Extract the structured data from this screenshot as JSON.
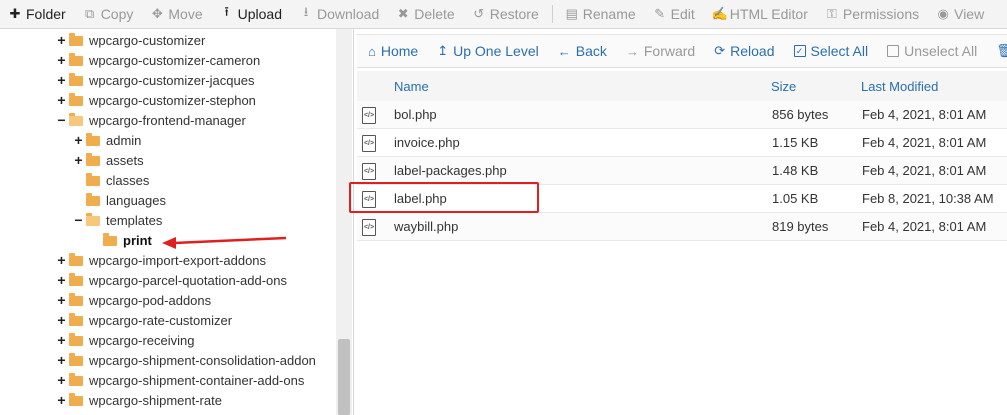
{
  "toolbar": {
    "buttons": [
      {
        "label": "Folder",
        "icon": "plus-icon",
        "glyph": "✚",
        "enabled": true
      },
      {
        "label": "Copy",
        "icon": "copy-icon",
        "glyph": "⧉",
        "enabled": false
      },
      {
        "label": "Move",
        "icon": "move-icon",
        "glyph": "✥",
        "enabled": false
      },
      {
        "label": "Upload",
        "icon": "upload-icon",
        "glyph": "⭱",
        "enabled": true
      },
      {
        "label": "Download",
        "icon": "download-icon",
        "glyph": "⭳",
        "enabled": false
      },
      {
        "label": "Delete",
        "icon": "delete-icon",
        "glyph": "✖",
        "enabled": false
      },
      {
        "label": "Restore",
        "icon": "restore-icon",
        "glyph": "↺",
        "enabled": false
      },
      {
        "label": "Rename",
        "icon": "rename-icon",
        "glyph": "▤",
        "enabled": false
      },
      {
        "label": "Edit",
        "icon": "edit-icon",
        "glyph": "✎",
        "enabled": false
      },
      {
        "label": "HTML Editor",
        "icon": "html-editor-icon",
        "glyph": "✍",
        "enabled": false
      },
      {
        "label": "Permissions",
        "icon": "key-icon",
        "glyph": "⚿",
        "enabled": false
      },
      {
        "label": "View",
        "icon": "eye-icon",
        "glyph": "◉",
        "enabled": false
      }
    ]
  },
  "tree": {
    "items": [
      {
        "label": "wpcargo-customizer",
        "toggle": "+",
        "depth": 0,
        "open": false
      },
      {
        "label": "wpcargo-customizer-cameron",
        "toggle": "+",
        "depth": 0,
        "open": false
      },
      {
        "label": "wpcargo-customizer-jacques",
        "toggle": "+",
        "depth": 0,
        "open": false
      },
      {
        "label": "wpcargo-customizer-stephon",
        "toggle": "+",
        "depth": 0,
        "open": false
      },
      {
        "label": "wpcargo-frontend-manager",
        "toggle": "−",
        "depth": 0,
        "open": true
      },
      {
        "label": "admin",
        "toggle": "+",
        "depth": 1,
        "open": false
      },
      {
        "label": "assets",
        "toggle": "+",
        "depth": 1,
        "open": false
      },
      {
        "label": "classes",
        "toggle": "",
        "depth": 1,
        "open": false
      },
      {
        "label": "languages",
        "toggle": "",
        "depth": 1,
        "open": false
      },
      {
        "label": "templates",
        "toggle": "−",
        "depth": 1,
        "open": true
      },
      {
        "label": "print",
        "toggle": "",
        "depth": 2,
        "open": false,
        "current": true
      },
      {
        "label": "wpcargo-import-export-addons",
        "toggle": "+",
        "depth": 0,
        "open": false
      },
      {
        "label": "wpcargo-parcel-quotation-add-ons",
        "toggle": "+",
        "depth": 0,
        "open": false
      },
      {
        "label": "wpcargo-pod-addons",
        "toggle": "+",
        "depth": 0,
        "open": false
      },
      {
        "label": "wpcargo-rate-customizer",
        "toggle": "+",
        "depth": 0,
        "open": false
      },
      {
        "label": "wpcargo-receiving",
        "toggle": "+",
        "depth": 0,
        "open": false
      },
      {
        "label": "wpcargo-shipment-consolidation-addon",
        "toggle": "+",
        "depth": 0,
        "open": false
      },
      {
        "label": "wpcargo-shipment-container-add-ons",
        "toggle": "+",
        "depth": 0,
        "open": false
      },
      {
        "label": "wpcargo-shipment-rate",
        "toggle": "+",
        "depth": 0,
        "open": false
      }
    ]
  },
  "nav": {
    "buttons": [
      {
        "label": "Home",
        "icon": "home-icon",
        "glyph": "⌂",
        "enabled": true
      },
      {
        "label": "Up One Level",
        "icon": "up-level-icon",
        "glyph": "↥",
        "enabled": true
      },
      {
        "label": "Back",
        "icon": "back-icon",
        "glyph": "←",
        "enabled": true
      },
      {
        "label": "Forward",
        "icon": "forward-icon",
        "glyph": "→",
        "enabled": false
      },
      {
        "label": "Reload",
        "icon": "reload-icon",
        "glyph": "⟳",
        "enabled": true
      },
      {
        "label": "Select All",
        "icon": "checkbox-checked-icon",
        "glyph": "✓",
        "enabled": true
      },
      {
        "label": "Unselect All",
        "icon": "checkbox-empty-icon",
        "glyph": "",
        "enabled": false
      },
      {
        "label": "",
        "icon": "trash-icon",
        "glyph": "🗑",
        "enabled": true
      }
    ]
  },
  "table": {
    "columns": {
      "name": "Name",
      "size": "Size",
      "modified": "Last Modified"
    },
    "rows": [
      {
        "name": "bol.php",
        "size": "856 bytes",
        "modified": "Feb 4, 2021, 8:01 AM"
      },
      {
        "name": "invoice.php",
        "size": "1.15 KB",
        "modified": "Feb 4, 2021, 8:01 AM"
      },
      {
        "name": "label-packages.php",
        "size": "1.48 KB",
        "modified": "Feb 4, 2021, 8:01 AM"
      },
      {
        "name": "label.php",
        "size": "1.05 KB",
        "modified": "Feb 8, 2021, 10:38 AM",
        "highlighted": true
      },
      {
        "name": "waybill.php",
        "size": "819 bytes",
        "modified": "Feb 4, 2021, 8:01 AM"
      }
    ]
  },
  "colors": {
    "link_blue": "#2a6fb0",
    "folder": "#f0ad4e",
    "highlight_red": "#e02020"
  }
}
